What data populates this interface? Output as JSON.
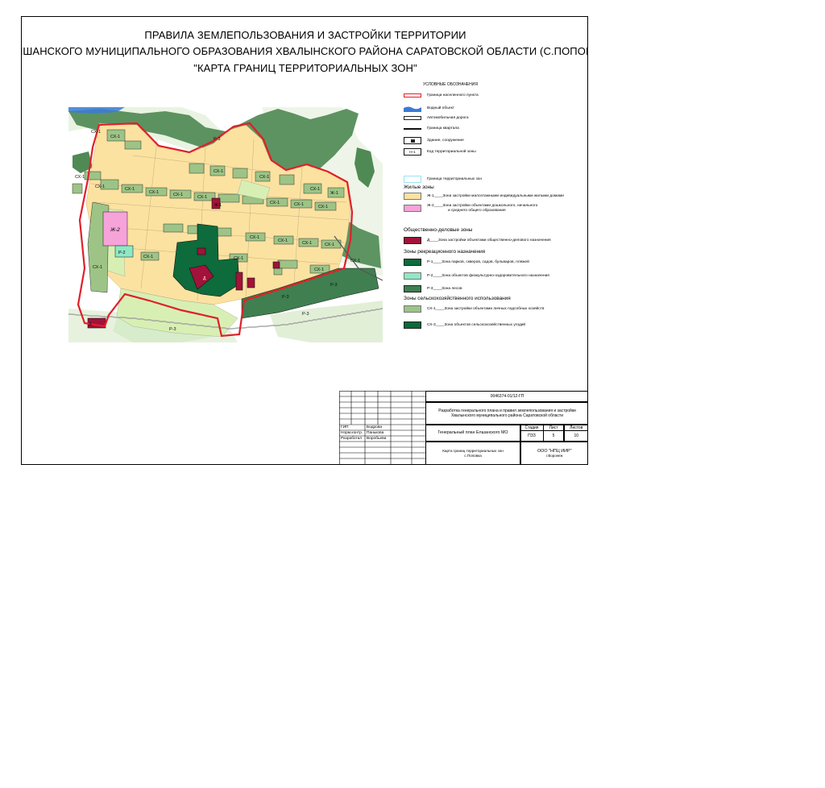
{
  "title": {
    "line1": "ПРАВИЛА ЗЕМЛЕПОЛЬЗОВАНИЯ И ЗАСТРОЙКИ ТЕРРИТОРИИ",
    "line2": "ЕЛШАНСКОГО МУНИЦИПАЛЬНОГО ОБРАЗОВАНИЯ  ХВАЛЫНСКОГО РАЙОНА САРАТОВСКОЙ ОБЛАСТИ (С.ПОПОВКА)",
    "line3": "\"КАРТА ГРАНИЦ ТЕРРИТОРИАЛЬНЫХ ЗОН\""
  },
  "colors": {
    "boundary": "#e0202a",
    "residential": "#fbe2a0",
    "residential_school": "#f5a3d8",
    "public": "#a3123a",
    "parks": "#0d6b3c",
    "sport": "#8fe8c4",
    "forest": "#3f7f50",
    "garden": "#9dc486",
    "agri": "#0a6a3a",
    "light_green": "#d8efb4",
    "water": "#3a7ad8",
    "forest_outside": "#4f8a55"
  },
  "map": {
    "zone_labels": {
      "zh1": "Ж-1",
      "zh2": "Ж-2",
      "sx1": "СХ-1",
      "r2": "Р-2",
      "r3": "Р-3",
      "d": "Д"
    }
  },
  "legend": {
    "heading": "УСЛОВНЫЕ ОБОЗНАЧЕНИЯ",
    "items": [
      {
        "text": "Граница населенного пункта"
      },
      {
        "text": "Водный объект"
      },
      {
        "text": "Автомобильная дорога"
      },
      {
        "text": "Граница квартала"
      },
      {
        "text": "Здание, сооружение"
      },
      {
        "text": "Код территориальной зоны",
        "code": "Н-1"
      },
      {
        "text": "Граница территориальных зон"
      }
    ],
    "groups": [
      {
        "title": "Жилые зоны",
        "items": [
          {
            "text": "Ж-1____Зона застройки малоэтажными индивидуальными жилыми домами"
          },
          {
            "text": "Ж-2____Зона застройки объектами дошкольного, начального",
            "text2": "и среднего общего образования"
          }
        ]
      },
      {
        "title": "Общественно-деловые зоны",
        "items": [
          {
            "text": "Д____Зона застройки объектами общественно-делового назначения"
          }
        ]
      },
      {
        "title": "Зоны рекреационного назначения",
        "items": [
          {
            "text": "Р-1____Зона парков, скверов, садов, бульваров, пляжей"
          },
          {
            "text": "Р-2____Зона объектов физкультурно-оздоровительного назначения"
          },
          {
            "text": "Р-3____Зона лесов"
          }
        ]
      },
      {
        "title": "Зоны сельскохозяйственного использования",
        "items": [
          {
            "text": "СХ-1____Зона застройки объектами личных подсобных хозяйств"
          },
          {
            "text": "СХ-3____Зона объектов сельскохозяйственных угодий"
          }
        ]
      }
    ]
  },
  "stamp": {
    "code": "0046374-01/12-ГП",
    "project": "Разработка генерального плана и правил землепользования и застройки Хвалынского муниципального района  Саратовской области",
    "name": "Генеральный план Елшанского МО",
    "sheet_title": "Карта границ территориальных зон с.Поповка",
    "org": "ООО \"НПЦ ИИР\"",
    "city": "г.Воронеж",
    "stage_label": "Стадия",
    "sheet_label": "Лист",
    "sheets_label": "Листов",
    "stage": "ПЗЗ",
    "sheet": "5",
    "sheets": "10",
    "roles": [
      {
        "role": "ГИП",
        "person": "Бодрова"
      },
      {
        "role": "Норм.контр.",
        "person": "Панькова"
      },
      {
        "role": "Разработал",
        "person": "Воробьева"
      }
    ]
  }
}
